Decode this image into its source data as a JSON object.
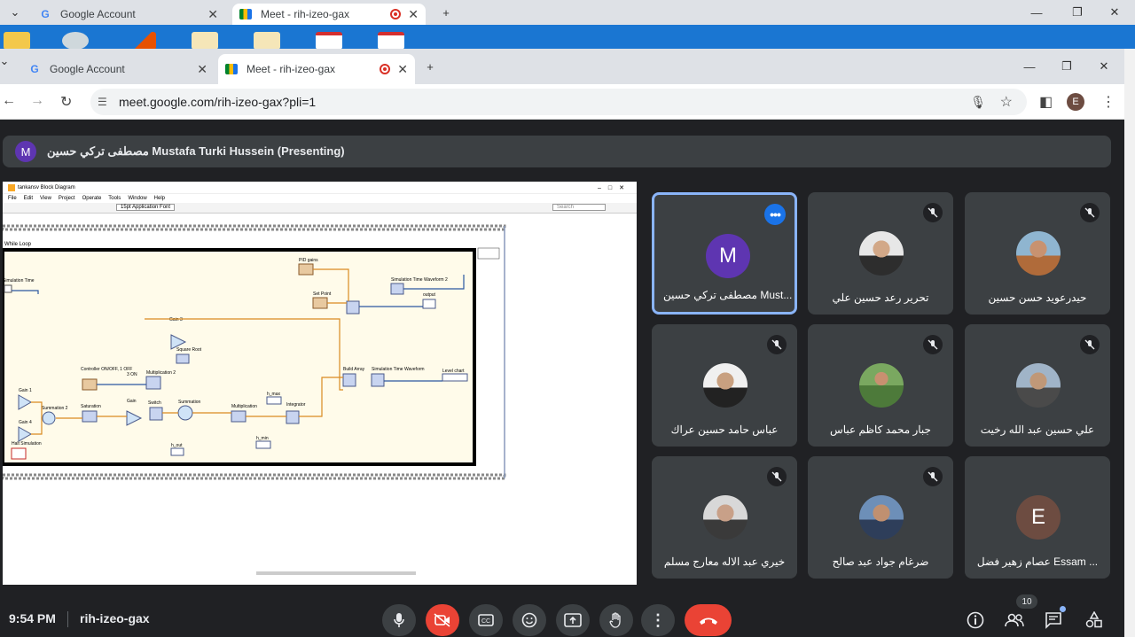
{
  "back_window": {
    "tabs": [
      {
        "label": "Google Account"
      },
      {
        "label": "Meet - rih-izeo-gax"
      }
    ]
  },
  "front_window": {
    "tabs": [
      {
        "label": "Google Account"
      },
      {
        "label": "Meet - rih-izeo-gax"
      }
    ],
    "url": "meet.google.com/rih-izeo-gax?pli=1",
    "profile_initial": "E"
  },
  "presenter": {
    "initial": "M",
    "label": "مصطفى تركي حسين Mustafa Turki Hussein (Presenting)"
  },
  "shared_screen": {
    "window_title": "tankansv Block Diagram",
    "menu": [
      "File",
      "Edit",
      "View",
      "Project",
      "Operate",
      "Tools",
      "Window",
      "Help"
    ],
    "font_select": "15pt Application Font",
    "search_placeholder": "Search",
    "loop_label": "While Loop",
    "blocks": [
      "PID gains",
      "Set Point",
      "Simulation Time Waveform 2",
      "output",
      "Simulation Time",
      "Gain 3",
      "Square Root",
      "Controller ON/OFF, 1 OFF",
      "3 ON",
      "Multiplication 2",
      "Gain 1",
      "Gain 4",
      "Summation 2",
      "Saturation",
      "Gain",
      "Switch",
      "Summation",
      "Multiplication",
      "h_max",
      "Integrator",
      "Build Array",
      "Simulation Time Waveform",
      "Level chart",
      "h_out",
      "Halt Simulation",
      "h_min"
    ]
  },
  "participants": [
    {
      "name": "مصطفى تركي حسين Must...",
      "initial": "M",
      "color": "#5e35b1",
      "muted": false,
      "active": true
    },
    {
      "name": "تحرير رعد حسين علي",
      "muted": true
    },
    {
      "name": "حيدرعويد حسن حسين",
      "muted": true
    },
    {
      "name": "عباس حامد حسين عراك",
      "muted": true
    },
    {
      "name": "جبار محمد كاظم عباس",
      "muted": true
    },
    {
      "name": "علي حسين عبد الله رخيت",
      "muted": true
    },
    {
      "name": "خيري عبد الاله معارج مسلم",
      "muted": true
    },
    {
      "name": "ضرغام جواد عبد صالح",
      "muted": true
    },
    {
      "name": "عصام زهير فضل Essam ...",
      "initial": "E",
      "color": "#6d4c41",
      "muted": false
    }
  ],
  "bottom_bar": {
    "time": "9:54 PM",
    "meeting_code": "rih-izeo-gax",
    "people_count": "10"
  },
  "colors": {
    "accent": "#8ab4f8",
    "end_call": "#ea4335",
    "bg": "#202124",
    "tile": "#3c4043"
  }
}
